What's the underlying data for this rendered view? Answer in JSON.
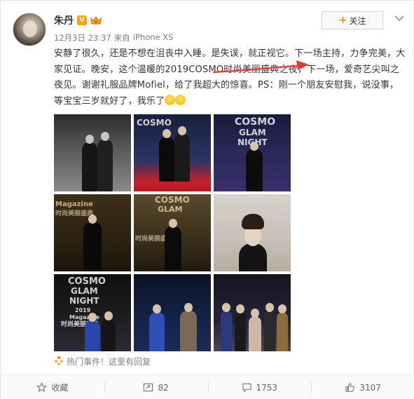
{
  "user": {
    "name": "朱丹",
    "vip_badge": "V"
  },
  "meta": {
    "time": "12月3日 23:37",
    "source_prefix": "来自",
    "source": "iPhone XS"
  },
  "follow_button": {
    "plus": "+",
    "label": "关注"
  },
  "post": {
    "text": "安静了很久，还是不想在沮丧中入睡。是失误，就正视它。下一场主持，力争完美，大家见证。晚安，这个温暖的2019COSMO时尚美丽盛典之夜，下一场，爱奇艺尖叫之夜见。谢谢礼服品牌Mofiel，给了我超大的惊喜。PS：刚一个朋友安慰我，说没事，等宝宝三岁就好了，我乐了"
  },
  "photos": [
    {
      "id": "photo-1"
    },
    {
      "id": "photo-2"
    },
    {
      "id": "photo-3"
    },
    {
      "id": "photo-4"
    },
    {
      "id": "photo-5"
    },
    {
      "id": "photo-6"
    },
    {
      "id": "photo-7"
    },
    {
      "id": "photo-8"
    },
    {
      "id": "photo-9"
    }
  ],
  "photo_text": {
    "cosmo": "COSMO",
    "glam": "GLAM",
    "night": "NIGHT",
    "magazine": "Magazine",
    "year": "2019",
    "event_cn": "时尚美丽盛典"
  },
  "hot_topic": "热门事件！这里有回复",
  "actions": {
    "favorite": "收藏",
    "repost": "82",
    "comment": "1753",
    "like": "3107"
  },
  "colors": {
    "accent_orange": "#ff8200",
    "vip_gold": "#f7a300",
    "arrow_red": "#e53935"
  }
}
